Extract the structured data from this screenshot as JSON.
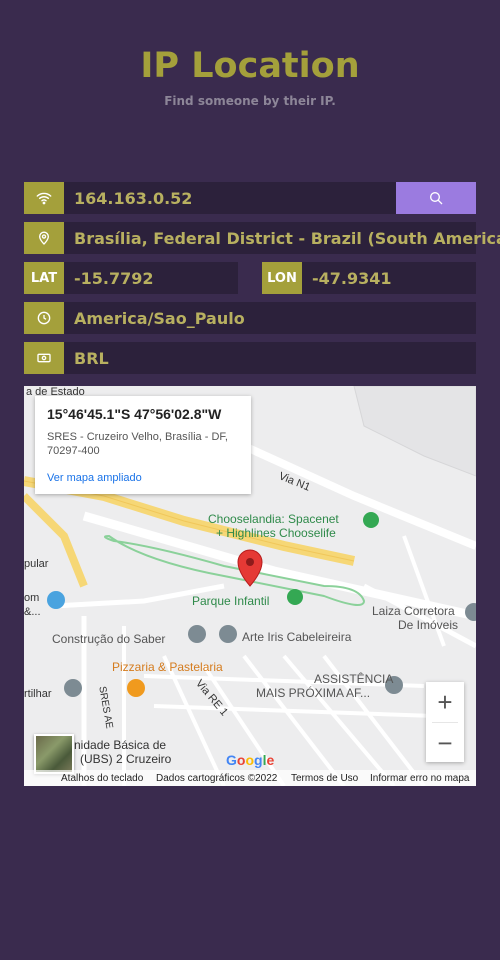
{
  "header": {
    "title": "IP Location",
    "subtitle": "Find someone by their IP."
  },
  "search": {
    "ip_value": "164.163.0.52",
    "icon": "wifi-icon",
    "button_icon": "search-icon"
  },
  "info": {
    "location": "Brasília, Federal District - Brazil (South America)",
    "lat_label": "LAT",
    "lat": "-15.7792",
    "lon_label": "LON",
    "lon": "-47.9341",
    "timezone": "America/Sao_Paulo",
    "currency": "BRL"
  },
  "map": {
    "infobox": {
      "coords": "15°46'45.1\"S 47°56'02.8\"W",
      "address": "SRES - Cruzeiro Velho, Brasília - DF, 70297-400",
      "link": "Ver mapa ampliado"
    },
    "labels": {
      "choose": "Chooselandia: Spacenet",
      "choose2": "+ Highlines Chooselife",
      "parque": "Parque Infantil",
      "laiza": "Laiza Corretora",
      "laiza2": "De Imóveis",
      "construcao": "Construção do Saber",
      "arte": "Arte Iris Cabeleireira",
      "pizzaria": "Pizzaria & Pastelaria",
      "assistencia": "ASSISTÊNCIA",
      "assistencia2": "MAIS PRÓXIMA AF...",
      "ubs": "nidade Básica de",
      "ubs2": "(UBS) 2 Cruzeiro",
      "via_n1": "Via N1",
      "via_re1": "Via RE 1",
      "sres_ae": "SRES AE",
      "estado": "a de Estado",
      "pular": "pular",
      "om": "om",
      "om2": "&...",
      "rtilhar": "rtilhar",
      "ta": "TA",
      "google": "Google"
    },
    "footer": {
      "shortcuts": "Atalhos do teclado",
      "data": "Dados cartográficos ©2022",
      "terms": "Termos de Uso",
      "report": "Informar erro no mapa"
    },
    "zoom_in": "+",
    "zoom_out": "−"
  },
  "colors": {
    "background": "#3a2b4e",
    "accent": "#a4a03b",
    "button": "#9b7be0",
    "field": "#2c213b"
  }
}
